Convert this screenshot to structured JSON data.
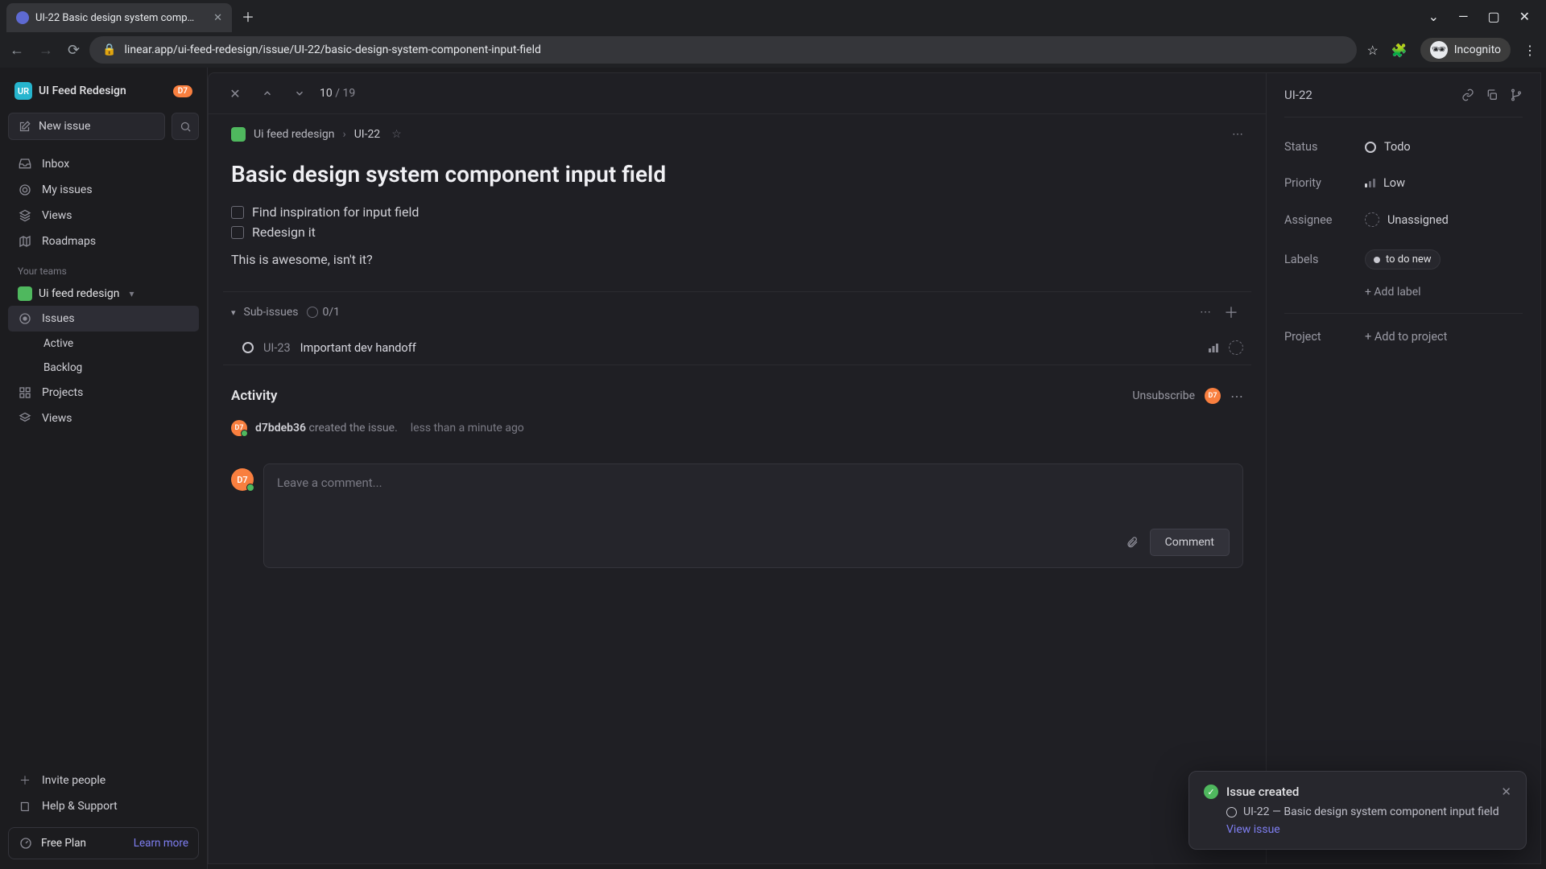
{
  "browser": {
    "tab_title": "UI-22 Basic design system comp…",
    "url": "linear.app/ui-feed-redesign/issue/UI-22/basic-design-system-component-input-field",
    "incognito": "Incognito"
  },
  "sidebar": {
    "workspace": "UI Feed Redesign",
    "workspace_badge": "D7",
    "new_issue": "New issue",
    "nav": {
      "inbox": "Inbox",
      "my_issues": "My issues",
      "views": "Views",
      "roadmaps": "Roadmaps"
    },
    "teams_label": "Your teams",
    "team_name": "Ui feed redesign",
    "team_nav": {
      "issues": "Issues",
      "active": "Active",
      "backlog": "Backlog",
      "projects": "Projects",
      "views": "Views"
    },
    "invite": "Invite people",
    "help": "Help & Support",
    "plan": "Free Plan",
    "learn_more": "Learn more"
  },
  "topbar": {
    "current": "10",
    "total": "19"
  },
  "breadcrumb": {
    "project": "Ui feed redesign",
    "issue_id": "UI-22"
  },
  "issue": {
    "title": "Basic design system component input field",
    "checks": [
      "Find inspiration for input field",
      "Redesign it"
    ],
    "body": "This is awesome, isn't it?"
  },
  "subissues": {
    "label": "Sub-issues",
    "count": "0/1",
    "items": [
      {
        "id": "UI-23",
        "title": "Important dev handoff"
      }
    ]
  },
  "activity": {
    "title": "Activity",
    "unsubscribe": "Unsubscribe",
    "log_user": "d7bdeb36",
    "log_action": "created the issue.",
    "log_time": "less than a minute ago",
    "comment_placeholder": "Leave a comment...",
    "comment_btn": "Comment"
  },
  "right": {
    "id": "UI-22",
    "status_label": "Status",
    "status_value": "Todo",
    "priority_label": "Priority",
    "priority_value": "Low",
    "assignee_label": "Assignee",
    "assignee_value": "Unassigned",
    "labels_label": "Labels",
    "label_value": "to do new",
    "add_label": "+ Add label",
    "project_label": "Project",
    "add_project": "+ Add to project"
  },
  "toast": {
    "title": "Issue created",
    "body": "UI-22 — Basic design system component input field",
    "link": "View issue"
  }
}
